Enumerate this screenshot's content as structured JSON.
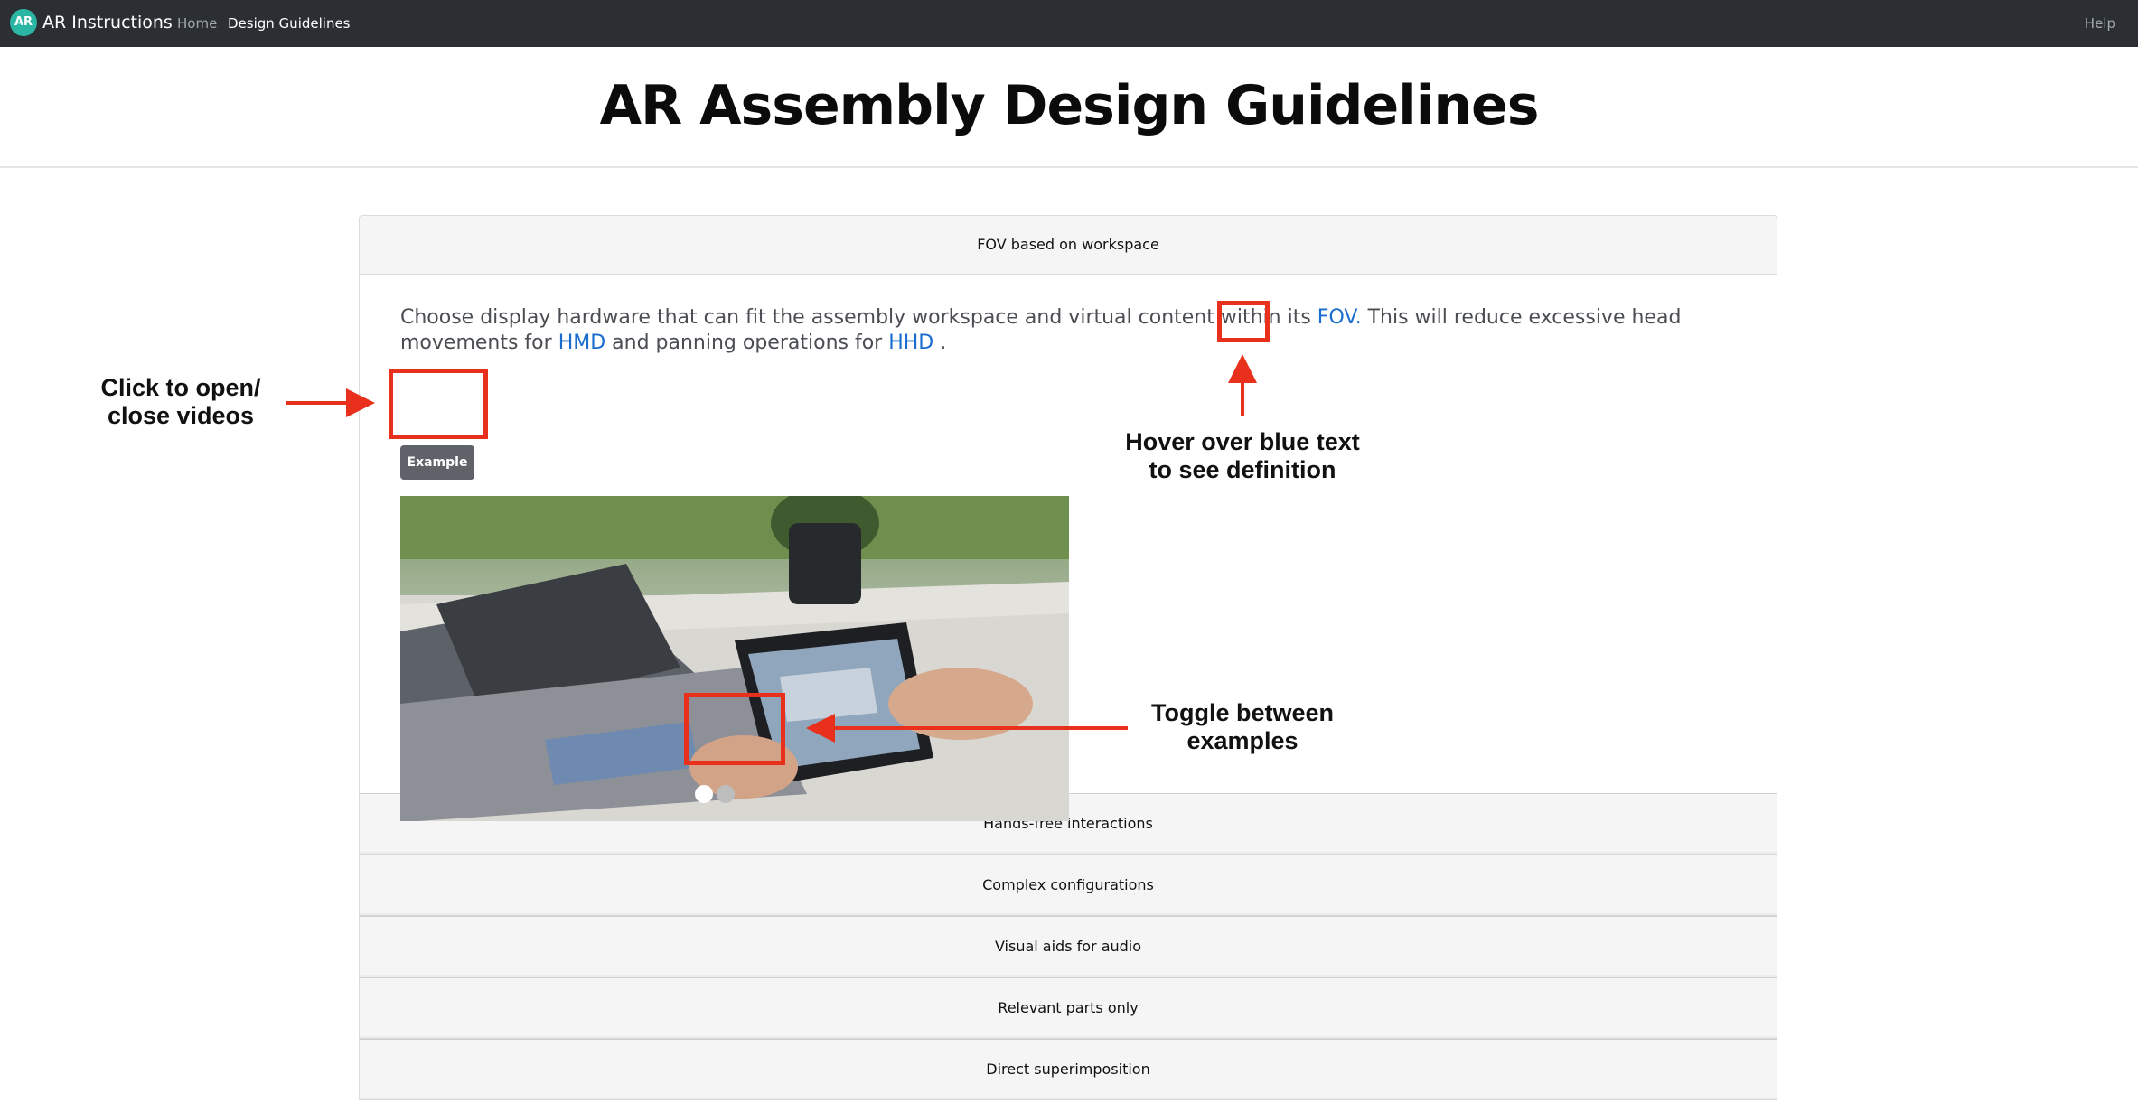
{
  "navbar": {
    "logo_text": "AR",
    "brand": "AR Instructions",
    "links": [
      "Home",
      "Design Guidelines"
    ],
    "help": "Help"
  },
  "page_title": "AR Assembly Design Guidelines",
  "accordion": {
    "open_section": {
      "title": "FOV based on workspace",
      "text_before": "Choose display hardware that can fit the assembly workspace and virtual content within its ",
      "term_fov": "FOV.",
      "text_middle": " This will reduce excessive head movements for ",
      "term_hmd": "HMD",
      "text_and": " and panning operations for ",
      "term_hhd": "HHD",
      "text_end": " .",
      "example_button": "Example"
    },
    "collapsed_sections": [
      "Hands-free interactions",
      "Complex configurations",
      "Visual aids for audio",
      "Relevant parts only",
      "Direct superimposition"
    ]
  },
  "annotations": {
    "open_close": "Click to open/\nclose videos",
    "hover": "Hover over blue text\nto see definition",
    "toggle": "Toggle between\nexamples"
  },
  "colors": {
    "navbar_bg": "#2b2f34",
    "logo": "#2bb5a3",
    "link_blue": "#1a6dcf",
    "annotation_red": "#e8301c"
  }
}
